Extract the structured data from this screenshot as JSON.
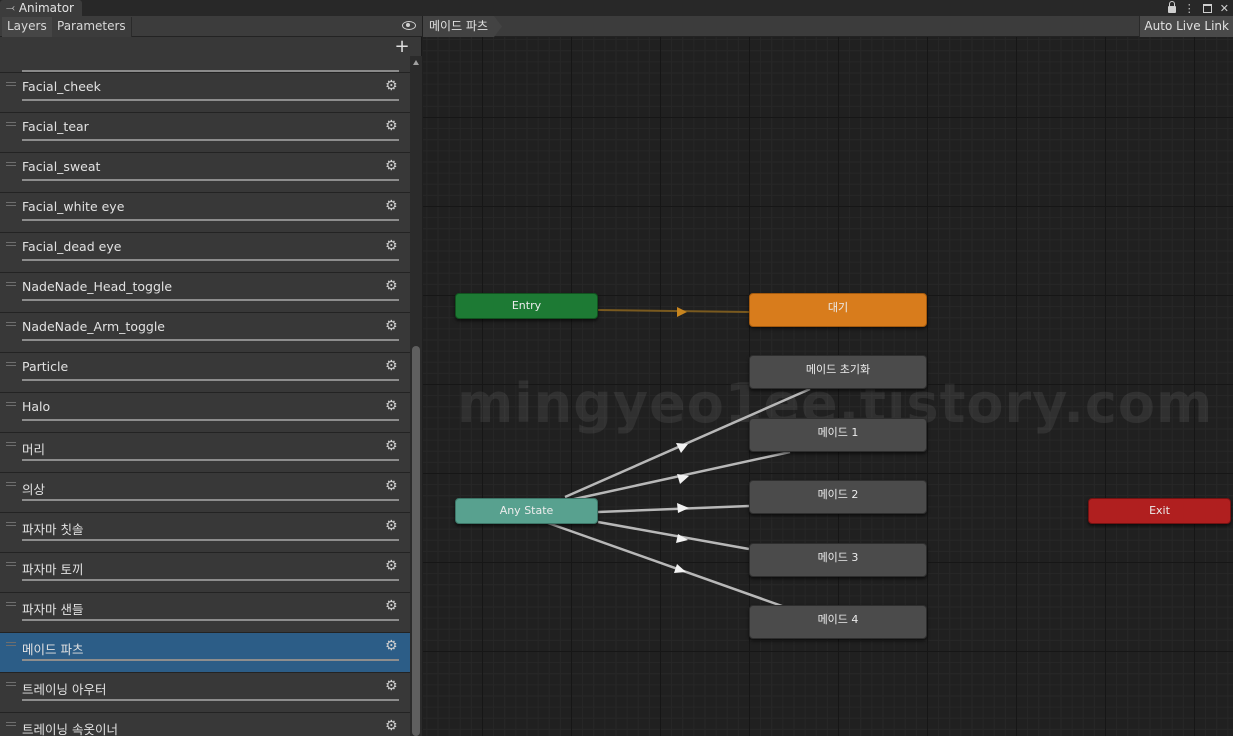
{
  "window": {
    "title": "Animator"
  },
  "left_panel": {
    "tabs": [
      {
        "label": "Layers"
      },
      {
        "label": "Parameters"
      }
    ],
    "add_label": "+",
    "layers": [
      {
        "name": "Facial_cheek"
      },
      {
        "name": "Facial_tear"
      },
      {
        "name": "Facial_sweat"
      },
      {
        "name": "Facial_white eye"
      },
      {
        "name": "Facial_dead eye"
      },
      {
        "name": "NadeNade_Head_toggle"
      },
      {
        "name": "NadeNade_Arm_toggle"
      },
      {
        "name": "Particle"
      },
      {
        "name": "Halo"
      },
      {
        "name": "머리"
      },
      {
        "name": "의상"
      },
      {
        "name": "파자마 칫솔"
      },
      {
        "name": "파자마 토끼"
      },
      {
        "name": "파자마 샌들"
      },
      {
        "name": "메이드 파츠"
      },
      {
        "name": "트레이닝 아우터"
      },
      {
        "name": "트레이닝 속옷이너"
      }
    ],
    "selected_layer": "메이드 파츠"
  },
  "graph": {
    "breadcrumb": "메이드 파츠",
    "auto_live_link": "Auto Live Link",
    "watermark": "mingyeo1ee.tistory.com",
    "nodes": {
      "entry": "Entry",
      "any_state": "Any State",
      "exit": "Exit",
      "default_state": "대기",
      "states": [
        "메이드 초기화",
        "메이드 1",
        "메이드 2",
        "메이드 3",
        "메이드 4"
      ]
    }
  },
  "colors": {
    "entry": "#1d7a34",
    "any_state": "#58a18f",
    "exit": "#b01f1f",
    "default_state": "#d87c1c",
    "state": "#4b4b4b",
    "selected_row": "#2c5d87"
  }
}
